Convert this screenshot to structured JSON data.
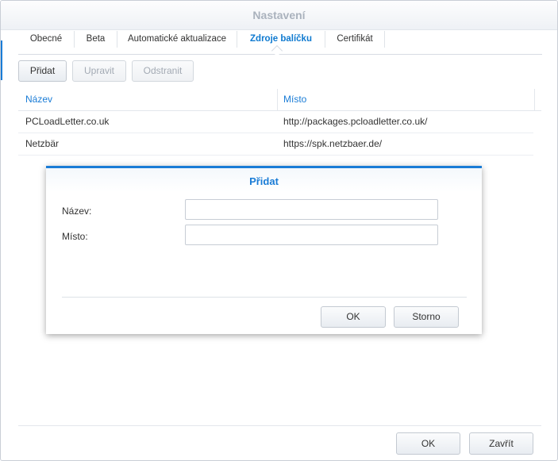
{
  "window": {
    "title": "Nastavení"
  },
  "tabs": [
    {
      "label": "Obecné",
      "active": false
    },
    {
      "label": "Beta",
      "active": false
    },
    {
      "label": "Automatické aktualizace",
      "active": false
    },
    {
      "label": "Zdroje balíčku",
      "active": true
    },
    {
      "label": "Certifikát",
      "active": false
    }
  ],
  "toolbar": {
    "add_label": "Přidat",
    "edit_label": "Upravit",
    "remove_label": "Odstranit"
  },
  "table": {
    "columns": [
      "Název",
      "Místo"
    ],
    "rows": [
      {
        "name": "PCLoadLetter.co.uk",
        "location": "http://packages.pcloadletter.co.uk/"
      },
      {
        "name": "Netzbär",
        "location": "https://spk.netzbaer.de/"
      }
    ]
  },
  "dialog": {
    "title": "Přidat",
    "name_label": "Název:",
    "location_label": "Místo:",
    "name_value": "",
    "location_value": "",
    "ok_label": "OK",
    "cancel_label": "Storno"
  },
  "footer": {
    "ok_label": "OK",
    "close_label": "Zavřít"
  },
  "colors": {
    "accent": "#1a7cd6",
    "title_inactive": "#aab2bd"
  }
}
